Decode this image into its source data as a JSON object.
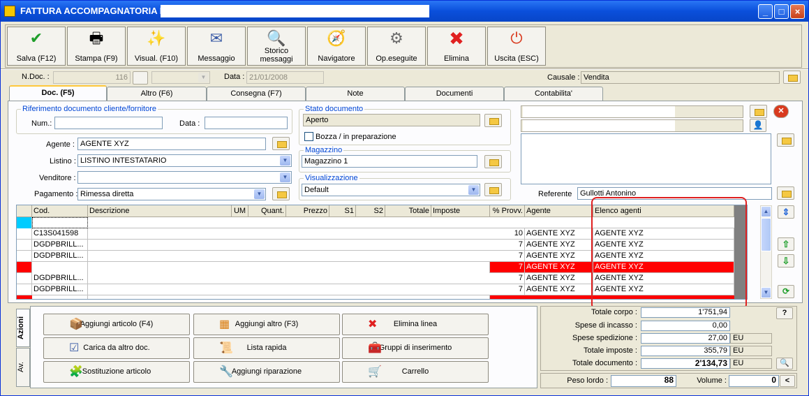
{
  "window": {
    "title": "FATTURA ACCOMPAGNATORIA N.",
    "title_field_value": "",
    "min": "_",
    "max": "□",
    "close": "×"
  },
  "toolbar": {
    "buttons": [
      {
        "label": "Salva (F12)",
        "icon": "✔"
      },
      {
        "label": "Stampa (F9)",
        "icon": "🖶"
      },
      {
        "label": "Visual. (F10)",
        "icon": "✨"
      },
      {
        "label": "Messaggio",
        "icon": "✉"
      },
      {
        "label": "Storico messaggi",
        "icon": "🔍"
      },
      {
        "label": "Navigatore",
        "icon": "🧭"
      },
      {
        "label": "Op.eseguite",
        "icon": "⚙"
      },
      {
        "label": "Elimina",
        "icon": "✖"
      },
      {
        "label": "Uscita (ESC)",
        "icon": "⏻"
      }
    ],
    "colors": {
      "save": "#1e9e2a",
      "delete": "#e02020",
      "exit": "#d93a1e"
    }
  },
  "header": {
    "ndoc_label": "N.Doc. :",
    "ndoc_value": "",
    "ndoc_number": "116",
    "ndoc_combo": "",
    "data_label": "Data :",
    "data_value": "21/01/2008",
    "causale_label": "Causale :",
    "causale_value": "Vendita"
  },
  "tabs": [
    "Doc. (F5)",
    "Altro (F6)",
    "Consegna (F7)",
    "Note",
    "Documenti",
    "Contabilita'"
  ],
  "riferimento": {
    "title": "Riferimento documento cliente/fornitore",
    "num_label": "Num.:",
    "num_value": "",
    "data_label": "Data :",
    "data_value": ""
  },
  "form": {
    "agente_label": "Agente :",
    "agente_value": "AGENTE XYZ",
    "listino_label": "Listino :",
    "listino_value": "LISTINO INTESTATARIO",
    "venditore_label": "Venditore :",
    "venditore_value": "",
    "pagamento_label": "Pagamento :",
    "pagamento_value": "Rimessa diretta"
  },
  "stato": {
    "title": "Stato documento",
    "value": "Aperto",
    "bozza_label": "Bozza / in preparazione"
  },
  "magazzino": {
    "title": "Magazzino",
    "value": "Magazzino 1"
  },
  "visualizzazione": {
    "title": "Visualizzazione",
    "value": "Default"
  },
  "cliente": {
    "line1": "",
    "line2": "",
    "address": "",
    "referente_label": "Referente",
    "referente_value": "Gullotti Antonino"
  },
  "grid": {
    "headers": [
      "Cod.",
      "Descrizione",
      "UM",
      "Quant.",
      "Prezzo",
      "S1",
      "S2",
      "Totale",
      "Imposte",
      "% Provv.",
      "Agente",
      "Elenco agenti"
    ],
    "rows": [
      {
        "cod": "",
        "provv": "",
        "agente": "",
        "elenco": "",
        "red": false,
        "cyan": true
      },
      {
        "cod": "C13S041598",
        "provv": "10",
        "agente": "AGENTE XYZ",
        "elenco": "AGENTE XYZ",
        "red": false
      },
      {
        "cod": "DGDPBRILL...",
        "provv": "7",
        "agente": "AGENTE XYZ",
        "elenco": "AGENTE XYZ",
        "red": false
      },
      {
        "cod": "DGDPBRILL...",
        "provv": "7",
        "agente": "AGENTE XYZ",
        "elenco": "AGENTE XYZ",
        "red": false
      },
      {
        "cod": "",
        "provv": "7",
        "agente": "AGENTE XYZ",
        "elenco": "AGENTE XYZ",
        "red": true
      },
      {
        "cod": "DGDPBRILL...",
        "provv": "7",
        "agente": "AGENTE XYZ",
        "elenco": "AGENTE XYZ",
        "red": false
      },
      {
        "cod": "DGDPBRILL...",
        "provv": "7",
        "agente": "AGENTE XYZ",
        "elenco": "AGENTE XYZ",
        "red": false
      }
    ]
  },
  "actions": {
    "tab_azioni": "Azioni",
    "tab_av": "Av.",
    "buttons": [
      {
        "label": "Aggiungi articolo (F4)",
        "icon": "📦"
      },
      {
        "label": "Aggiungi altro (F3)",
        "icon": "▦"
      },
      {
        "label": "Elimina linea",
        "icon": "✖"
      },
      {
        "label": "Carica da altro doc.",
        "icon": "☑"
      },
      {
        "label": "Lista rapida",
        "icon": "📜"
      },
      {
        "label": "Gruppi di inserimento",
        "icon": "🧰"
      },
      {
        "label": "Sostituzione articolo",
        "icon": "🧩"
      },
      {
        "label": "Aggiungi riparazione",
        "icon": "🔧"
      },
      {
        "label": "Carrello",
        "icon": "🛒"
      }
    ]
  },
  "totals": {
    "totale_corpo_label": "Totale corpo :",
    "totale_corpo_value": "1'751,94",
    "spese_incasso_label": "Spese di incasso :",
    "spese_incasso_value": "0,00",
    "spese_spedizione_label": "Spese spedizione :",
    "spese_spedizione_value": "27,00",
    "spese_spedizione_unit": "EU",
    "totale_imposte_label": "Totale imposte :",
    "totale_imposte_value": "355,79",
    "totale_imposte_unit": "EU",
    "totale_documento_label": "Totale documento :",
    "totale_documento_value": "2'134,73",
    "totale_documento_unit": "EU",
    "help": "?",
    "peso_label": "Peso lordo :",
    "peso_value": "88",
    "volume_label": "Volume :",
    "volume_value": "0",
    "volume_btn": "<"
  }
}
